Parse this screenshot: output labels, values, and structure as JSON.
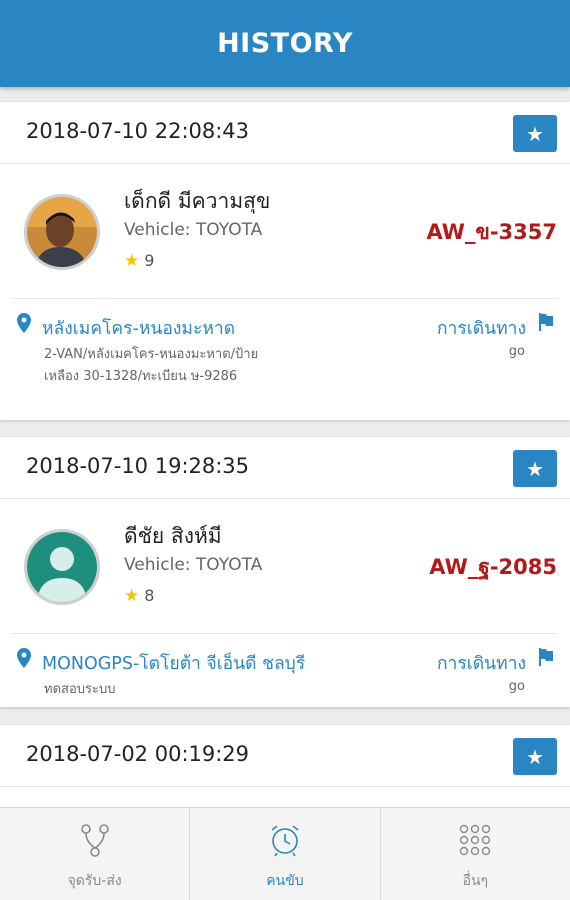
{
  "header": {
    "title": "HISTORY"
  },
  "history": [
    {
      "datetime": "2018-07-10 22:08:43",
      "driver_name": "เด็กดี มีความสุข",
      "vehicle": "Vehicle: TOYOTA",
      "rating": "9",
      "plate": "AW_ข-3357",
      "place": "หลังเมคโคร-หนองมะหาด",
      "address": "2-VAN/หลังเมคโคร-หนองมะหาด/ป้ายเหลือง 30-1328/ทะเบียน ษ-9286",
      "trip_label": "การเดินทาง",
      "status": "go",
      "avatar": "photo-avatar"
    },
    {
      "datetime": "2018-07-10 19:28:35",
      "driver_name": "ดีชัย สิงห์มี",
      "vehicle": "Vehicle: TOYOTA",
      "rating": "8",
      "plate": "AW_ฐ-2085",
      "place": "MONOGPS-โตโยต้า จีเอ็นดี ชลบุรี",
      "address": "ทดสอบระบบ",
      "trip_label": "การเดินทาง",
      "status": "go",
      "avatar": "default-user-avatar"
    },
    {
      "datetime": "2018-07-02 00:19:29"
    }
  ],
  "bottom_nav": [
    {
      "label": "จุดรับ-ส่ง",
      "icon": "route-nodes-icon",
      "active": false
    },
    {
      "label": "คนขับ",
      "icon": "alarm-clock-icon",
      "active": true
    },
    {
      "label": "อื่นๆ",
      "icon": "grid-dots-icon",
      "active": false
    }
  ],
  "colors": {
    "primary": "#2a86c3",
    "plate": "#b11a1a",
    "star": "#f5c500"
  }
}
